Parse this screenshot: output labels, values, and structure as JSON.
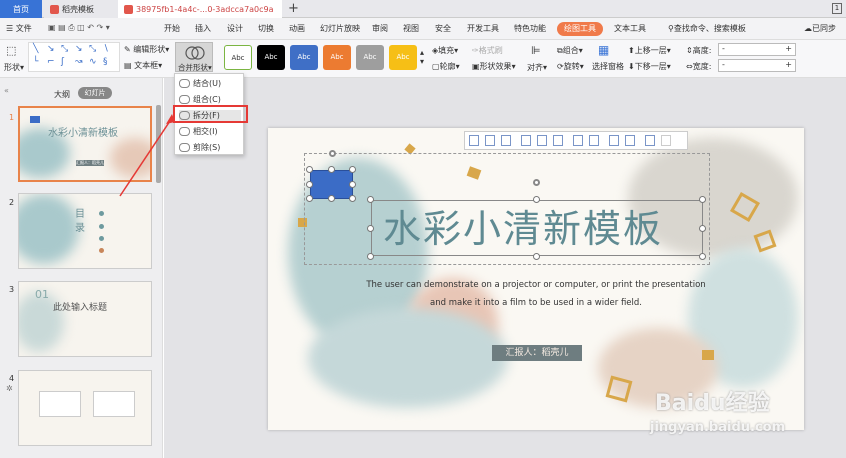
{
  "titlebar": {
    "home_tab": "首页",
    "doc_tab": "稻壳模板",
    "file_tab": "38975fb1-4a4c-...0-3adcca7a0c9a",
    "plus": "+",
    "badge": "1"
  },
  "menubar": {
    "file": "文件",
    "items": [
      "开始",
      "插入",
      "设计",
      "切换",
      "动画",
      "幻灯片放映",
      "审阅",
      "视图",
      "安全",
      "开发工具",
      "特色功能",
      "绘图工具",
      "文本工具"
    ],
    "active": "绘图工具",
    "search": "查找命令、搜索模板",
    "sync": "已同步"
  },
  "ribbon": {
    "shape_label": "形状",
    "edit_shape": "编辑形状",
    "text_box": "文本框",
    "merge_shape": "合并形状",
    "style_labels": [
      "Abc",
      "Abc",
      "Abc",
      "Abc",
      "Abc",
      "Abc"
    ],
    "fill": "填充",
    "format_painter": "格式刷",
    "outline": "轮廓",
    "shape_effect": "形状效果",
    "align": "对齐",
    "group": "组合",
    "rotate": "旋转",
    "selection_pane": "选择窗格",
    "bring_forward": "上移一层",
    "send_backward": "下移一层",
    "height": "高度:",
    "width": "宽度:",
    "height_value": "-",
    "width_value": "-"
  },
  "dropdown": {
    "items": [
      "结合(U)",
      "组合(C)",
      "拆分(F)",
      "相交(I)",
      "剪除(S)"
    ],
    "highlighted": "拆分(F)"
  },
  "left_pane": {
    "outline_tab": "大纲",
    "slides_tab": "幻灯片",
    "slide_numbers": [
      "1",
      "2",
      "3",
      "4"
    ],
    "thumb1_title": "水彩小清新模板",
    "thumb2_title": "目  录",
    "thumb3_title": "此处输入标题",
    "thumb3_num": "01",
    "thumb1_btn": "汇报人：稻壳儿"
  },
  "slide": {
    "title": "水彩小清新模板",
    "line1": "The user can demonstrate on a projector or computer, or print the presentation",
    "line2": "and make it into a film to be used in a wider field.",
    "reporter": "汇报人：稻壳儿"
  },
  "watermark": {
    "logo": "Baidu经验",
    "url": "jingyan.baidu.com"
  },
  "colors": {
    "accent": "#f07a4a",
    "home_tab": "#3873d6",
    "highlight_box": "#e53935",
    "blue_shape": "#3b6cc6"
  }
}
